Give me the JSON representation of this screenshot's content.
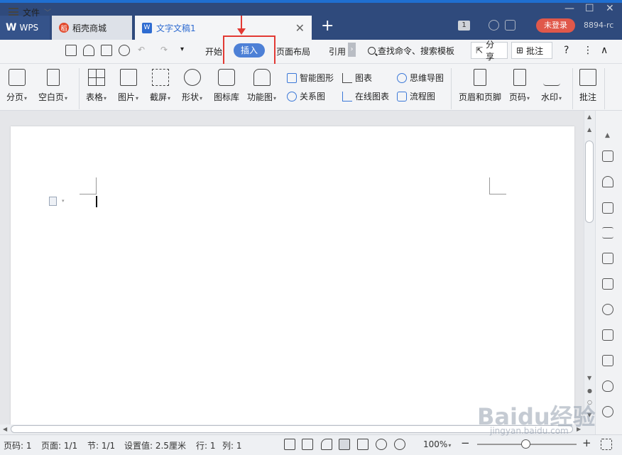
{
  "titlebar": {
    "tabs": [
      {
        "label": "WPS",
        "logo": "W"
      },
      {
        "label": "稻壳商城",
        "icon": "docer-icon"
      },
      {
        "label": "文字文稿1",
        "icon": "word-doc-icon"
      }
    ],
    "page_count": "1",
    "login": "未登录",
    "user_id": "8894-rc"
  },
  "menubar": {
    "file": "文件",
    "items": [
      "开始",
      "插入",
      "页面布局",
      "引用"
    ],
    "active": "插入",
    "search": "查找命令、搜索模板",
    "share": "分享",
    "comment": "批注",
    "help": "?",
    "more": "⋮",
    "collapse": "∧"
  },
  "ribbon": {
    "large": [
      "分页",
      "空白页",
      "表格",
      "图片",
      "截屏",
      "形状",
      "图标库",
      "功能图",
      "页眉和页脚",
      "页码",
      "水印",
      "批注"
    ],
    "small": [
      "智能图形",
      "图表",
      "思维导图",
      "关系图",
      "在线图表",
      "流程图"
    ]
  },
  "statusbar": {
    "page_num": "页码: 1",
    "pages": "页面: 1/1",
    "section": "节: 1/1",
    "setting": "设置值: 2.5厘米",
    "row": "行: 1",
    "col": "列: 1",
    "zoom": "100%"
  },
  "watermark": {
    "brand": "Baidu经验",
    "url": "jingyan.baidu.com"
  },
  "colors": {
    "titlebar": "#2f4a7c",
    "accent": "#4d80d6",
    "login": "#e0584a",
    "highlight": "#e23a34"
  }
}
